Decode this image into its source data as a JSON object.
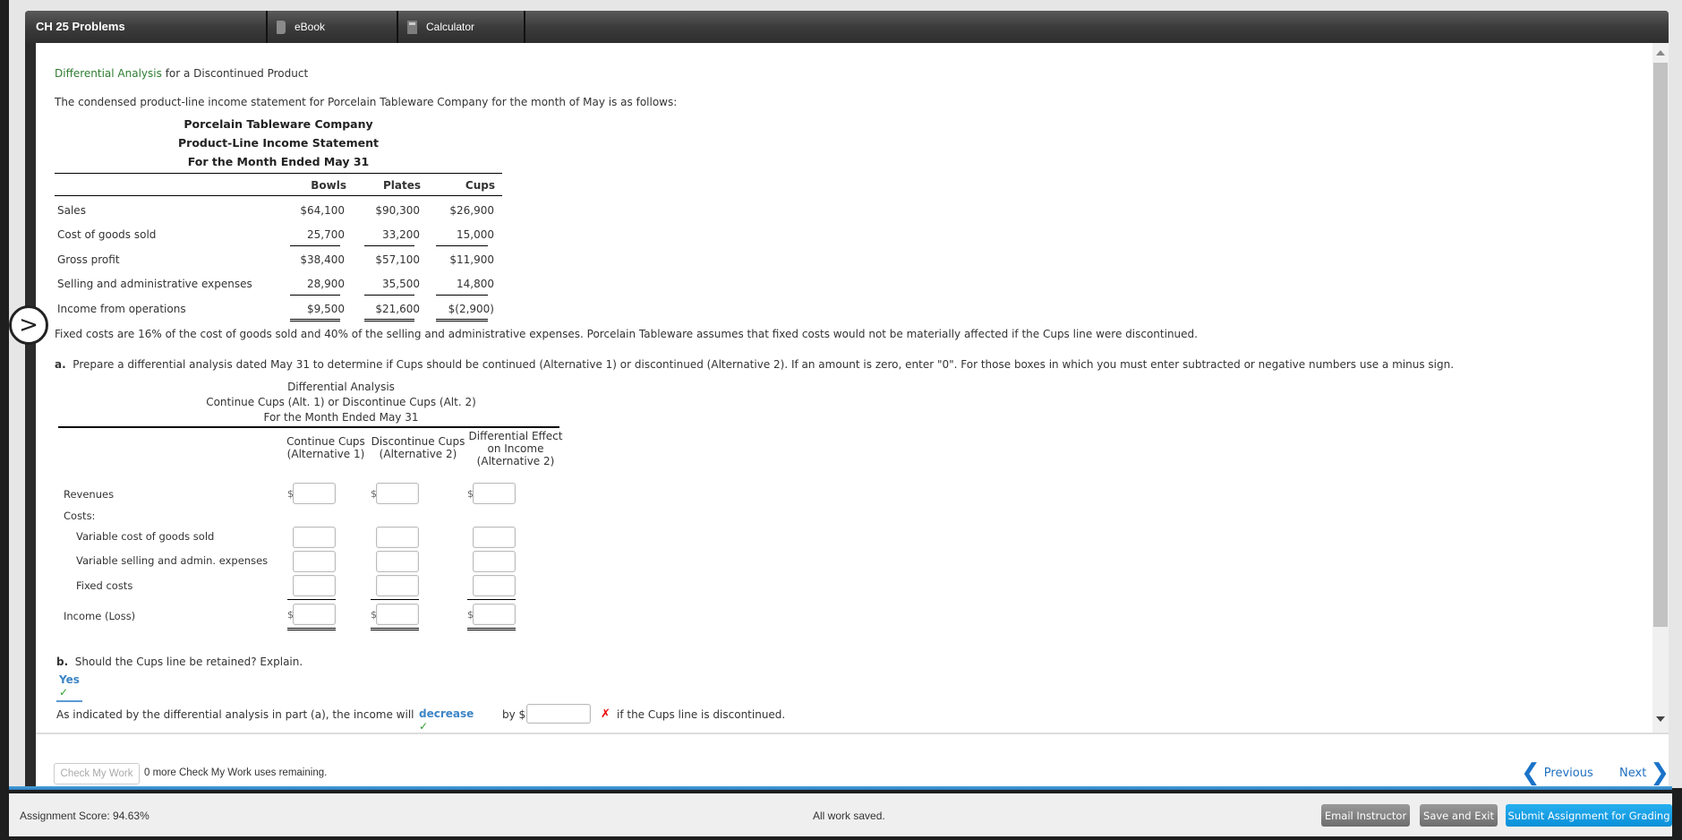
{
  "topbar": {
    "title": "CH 25 Problems",
    "tools": [
      {
        "label": "eBook",
        "icon": "book-icon"
      },
      {
        "label": "Calculator",
        "icon": "calculator-icon"
      }
    ]
  },
  "problem": {
    "title_link": "Differential Analysis",
    "title_rest": " for a Discontinued Product",
    "intro": "The condensed product-line income statement for Porcelain Tableware Company for the month of May is as follows:",
    "statement": {
      "heading": [
        "Porcelain Tableware Company",
        "Product-Line Income Statement",
        "For the Month Ended May 31"
      ],
      "columns": [
        "Bowls",
        "Plates",
        "Cups"
      ],
      "rows": [
        {
          "label": "Sales",
          "values": [
            "$64,100",
            "$90,300",
            "$26,900"
          ]
        },
        {
          "label": "Cost of goods sold",
          "values": [
            "25,700",
            "33,200",
            "15,000"
          ]
        },
        {
          "label": "Gross profit",
          "values": [
            "$38,400",
            "$57,100",
            "$11,900"
          ]
        },
        {
          "label": "Selling and administrative expenses",
          "values": [
            "28,900",
            "35,500",
            "14,800"
          ]
        },
        {
          "label": "Income from operations",
          "values": [
            "$9,500",
            "$21,600",
            "$(2,900)"
          ]
        }
      ]
    },
    "fixed_costs_note": "Fixed costs are 16% of the cost of goods sold and 40% of the selling and administrative expenses. Porcelain Tableware assumes that fixed costs would not be materially affected if the Cups line were discontinued.",
    "part_a": {
      "letter": "a.",
      "text": "Prepare a differential analysis dated May 31 to determine if Cups should be continued (Alternative 1) or discontinued (Alternative 2). If an amount is zero, enter \"0\". For those boxes in which you must enter subtracted or negative numbers use a minus sign.",
      "heading": [
        "Differential Analysis",
        "Continue Cups (Alt. 1) or Discontinue Cups (Alt. 2)",
        "For the Month Ended May 31"
      ],
      "columns": [
        "Continue Cups\n(Alternative 1)",
        "Discontinue Cups\n(Alternative 2)",
        "Differential Effect\non Income\n(Alternative 2)"
      ],
      "rows": [
        {
          "label": "Revenues",
          "values": [
            "",
            "",
            ""
          ]
        },
        {
          "label": "Costs:"
        },
        {
          "label": "Variable cost of goods sold",
          "values": [
            "",
            "",
            ""
          ]
        },
        {
          "label": "Variable selling and admin. expenses",
          "values": [
            "",
            "",
            ""
          ]
        },
        {
          "label": "Fixed costs",
          "values": [
            "",
            "",
            ""
          ]
        },
        {
          "label": "Income (Loss)",
          "values": [
            "",
            "",
            ""
          ]
        }
      ],
      "currency": "$"
    },
    "part_b": {
      "letter": "b.",
      "question": "Should the Cups line be retained? Explain.",
      "answer": "Yes",
      "sentence_start": "As indicated by the differential analysis in part (a), the income will",
      "direction": "decrease",
      "by_label": "by $",
      "amount": "",
      "sentence_end": "if the Cups line is discontinued."
    }
  },
  "footer": {
    "check_button": "Check My Work",
    "check_note": "0 more Check My Work uses remaining.",
    "previous": "Previous",
    "next": "Next"
  },
  "bottom": {
    "score": "Assignment Score: 94.63%",
    "saved": "All work saved.",
    "email": "Email Instructor",
    "save_exit": "Save and Exit",
    "submit": "Submit Assignment for Grading"
  },
  "colors": {
    "link_green": "#2e7d32",
    "answer_blue": "#3d85c6",
    "correct_green": "#2e9e2e",
    "incorrect_red": "#e00000",
    "submit_blue": "#0a8fd8"
  }
}
